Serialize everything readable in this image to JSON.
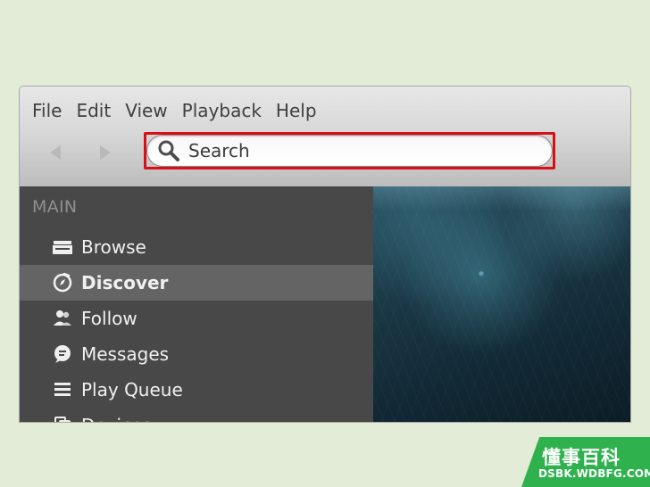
{
  "menu": {
    "items": [
      "File",
      "Edit",
      "View",
      "Playback",
      "Help"
    ]
  },
  "navigation": {
    "back_icon": "back-arrow-icon",
    "forward_icon": "forward-arrow-icon"
  },
  "search": {
    "placeholder": "Search",
    "icon": "search-icon",
    "highlight_color": "#d90f16"
  },
  "sidebar": {
    "section_header": "MAIN",
    "items": [
      {
        "label": "Browse",
        "icon": "browse-icon",
        "active": false
      },
      {
        "label": "Discover",
        "icon": "discover-icon",
        "active": true
      },
      {
        "label": "Follow",
        "icon": "follow-icon",
        "active": false
      },
      {
        "label": "Messages",
        "icon": "messages-icon",
        "active": false
      },
      {
        "label": "Play Queue",
        "icon": "play-queue-icon",
        "active": false
      },
      {
        "label": "Devices",
        "icon": "devices-icon",
        "active": false
      }
    ]
  },
  "watermark": {
    "text_cn": "懂事百科",
    "domain": "DSBK.WDBFG.COM"
  },
  "colors": {
    "background": "#e3ecd6",
    "sidebar_bg": "#484848",
    "sidebar_active": "#646464",
    "watermark_green": "#2fb14d"
  }
}
